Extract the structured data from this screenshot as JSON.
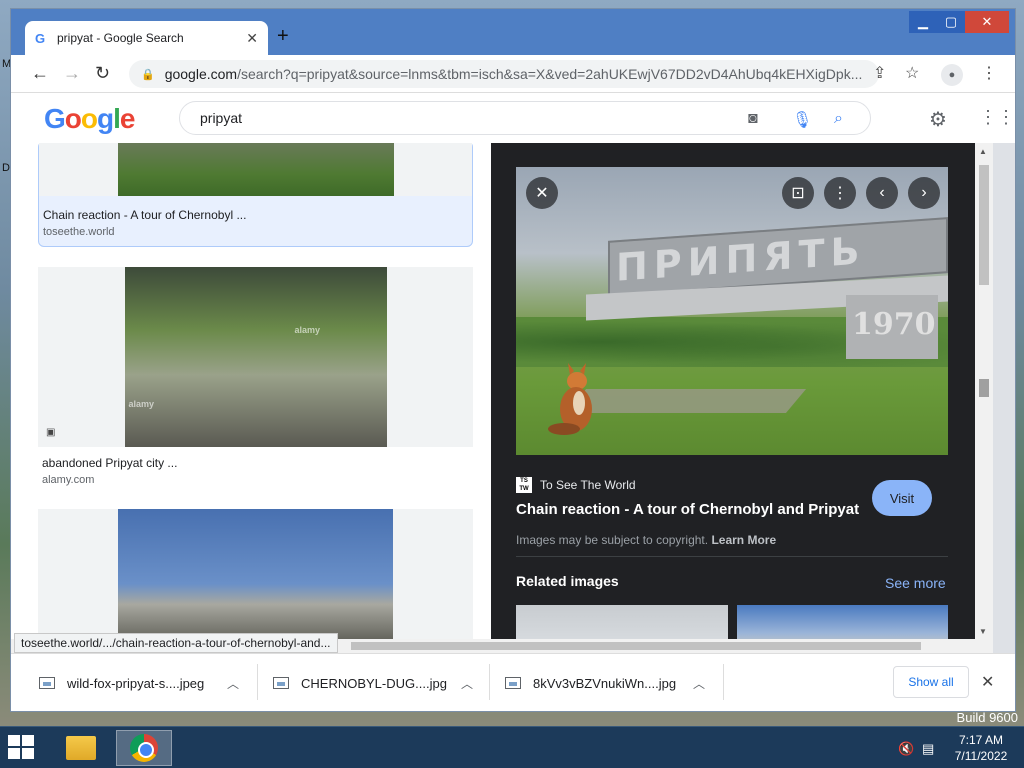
{
  "desktop": {
    "snippet_m": "M",
    "snippet_d": "D",
    "build": "Build 9600"
  },
  "browser": {
    "tab_title": "pripyat - Google Search",
    "tab_favicon": "G",
    "url_host": "google.com",
    "url_rest": "/search?q=pripyat&source=lnms&tbm=isch&sa=X&ved=2ahUKEwjV67DD2vD4AhUbq4kEHXigDpk..."
  },
  "google": {
    "logo_letters": [
      "G",
      "o",
      "o",
      "g",
      "l",
      "e"
    ],
    "query": "pripyat"
  },
  "results": [
    {
      "title": "Chain reaction - A tour of Chernobyl ...",
      "source": "toseethe.world"
    },
    {
      "title": "abandoned Pripyat city ...",
      "source": "alamy.com",
      "watermark": "alamy"
    },
    {
      "title": "",
      "source": ""
    }
  ],
  "status_url": "toseethe.world/.../chain-reaction-a-tour-of-chernobyl-and...",
  "preview": {
    "sign_text": "ПРИПЯТЬ",
    "year": "1970",
    "source_logo": "TS TW",
    "source_name": "To See The World",
    "title": "Chain reaction - A tour of Chernobyl and Pripyat",
    "visit_label": "Visit",
    "copyright_text": "Images may be subject to copyright.",
    "learn_more": "Learn More",
    "related_title": "Related images",
    "see_more": "See more"
  },
  "downloads": [
    {
      "name": "wild-fox-pripyat-s....jpeg"
    },
    {
      "name": "CHERNOBYL-DUG....jpg"
    },
    {
      "name": "8kVv3vBZVnukiWn....jpg"
    }
  ],
  "show_all": "Show all",
  "clock": {
    "time": "7:17 AM",
    "date": "7/11/2022"
  }
}
